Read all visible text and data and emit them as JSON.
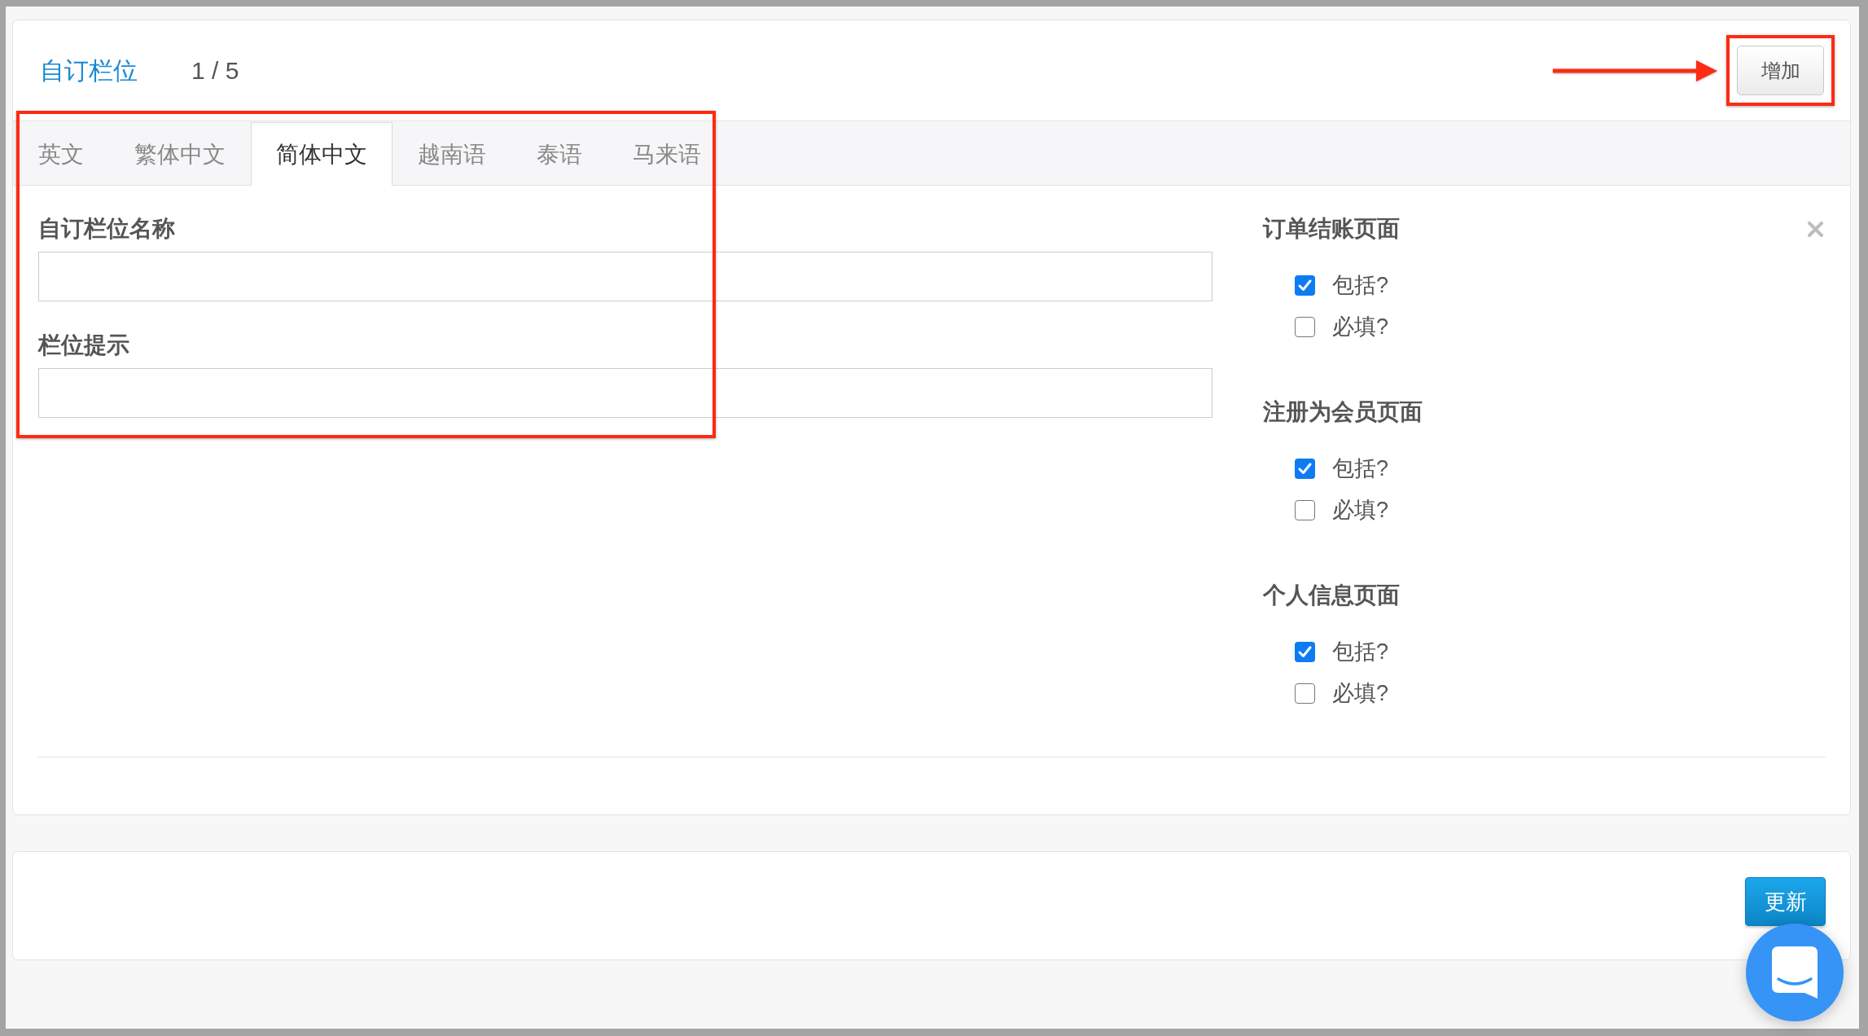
{
  "header": {
    "title": "自订栏位",
    "counter": "1 / 5",
    "add_button": {
      "label": "增加",
      "highlighted": true
    }
  },
  "form": {
    "highlighted": true,
    "tabs": [
      {
        "label": "英文",
        "selected": false
      },
      {
        "label": "繁体中文",
        "selected": false
      },
      {
        "label": "简体中文",
        "selected": true
      },
      {
        "label": "越南语",
        "selected": false
      },
      {
        "label": "泰语",
        "selected": false
      },
      {
        "label": "马来语",
        "selected": false
      }
    ],
    "fields": [
      {
        "label": "自订栏位名称"
      },
      {
        "label": "栏位提示"
      }
    ]
  },
  "pages": [
    {
      "title": "订单结账页面",
      "options": [
        {
          "label": "包括?",
          "checked": true
        },
        {
          "label": "必填?",
          "checked": false
        }
      ]
    },
    {
      "title": "注册为会员页面",
      "options": [
        {
          "label": "包括?",
          "checked": true
        },
        {
          "label": "必填?",
          "checked": false
        }
      ]
    },
    {
      "title": "个人信息页面",
      "options": [
        {
          "label": "包括?",
          "checked": true
        },
        {
          "label": "必填?",
          "checked": false
        }
      ]
    }
  ],
  "update_button": "更新"
}
